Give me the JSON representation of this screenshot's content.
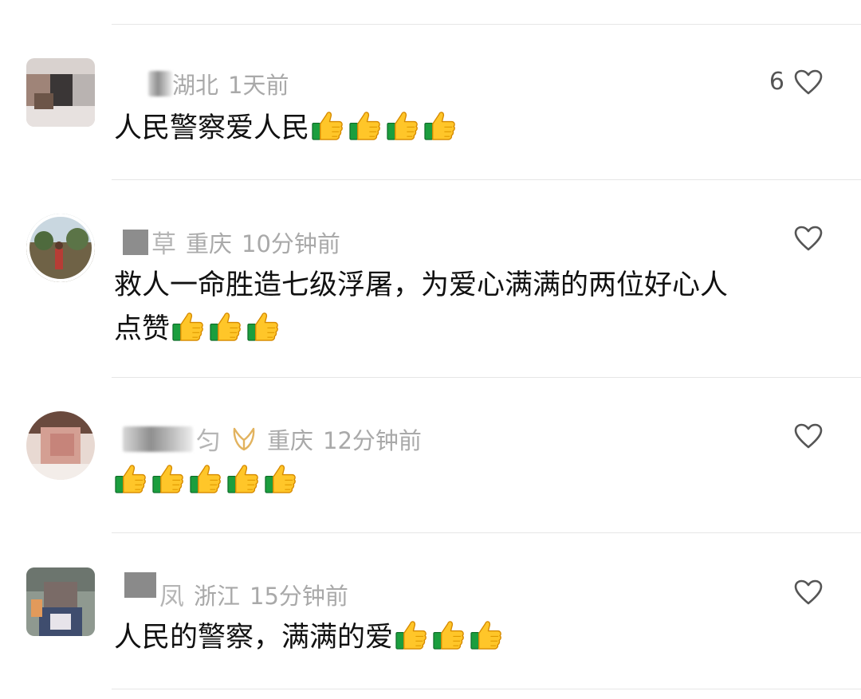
{
  "comments": [
    {
      "name_visible": "",
      "location": "湖北",
      "time": "1天前",
      "text": "人民警察爱人民",
      "text_line2": "",
      "like_count": "6",
      "thumbs_count": 4,
      "avatar_icon": "avatar-photo-icon"
    },
    {
      "name_visible": "草",
      "location": "重庆",
      "time": "10分钟前",
      "text": "救人一命胜造七级浮屠，为爱心满满的两位好心人",
      "text_line2": "点赞",
      "like_count": "",
      "thumbs_count": 3,
      "avatar_icon": "avatar-photo-icon"
    },
    {
      "name_visible": "匀",
      "location": "重庆",
      "time": "12分钟前",
      "text": "",
      "text_line2": "",
      "like_count": "",
      "thumbs_count": 5,
      "avatar_icon": "avatar-photo-icon",
      "badge_icon": "vip-badge-icon"
    },
    {
      "name_visible": "凤",
      "location": "浙江",
      "time": "15分钟前",
      "text": "人民的警察，满满的爱",
      "text_line2": "",
      "like_count": "",
      "thumbs_count": 3,
      "avatar_icon": "avatar-photo-icon"
    }
  ],
  "icons": {
    "like": "heart-outline-icon",
    "thumbs": "thumbs-up-emoji-icon"
  },
  "colors": {
    "meta_text": "#a9a9a9",
    "body_text": "#111111",
    "divider": "#e6e6e6",
    "vip_gold": "#e2b35f"
  }
}
